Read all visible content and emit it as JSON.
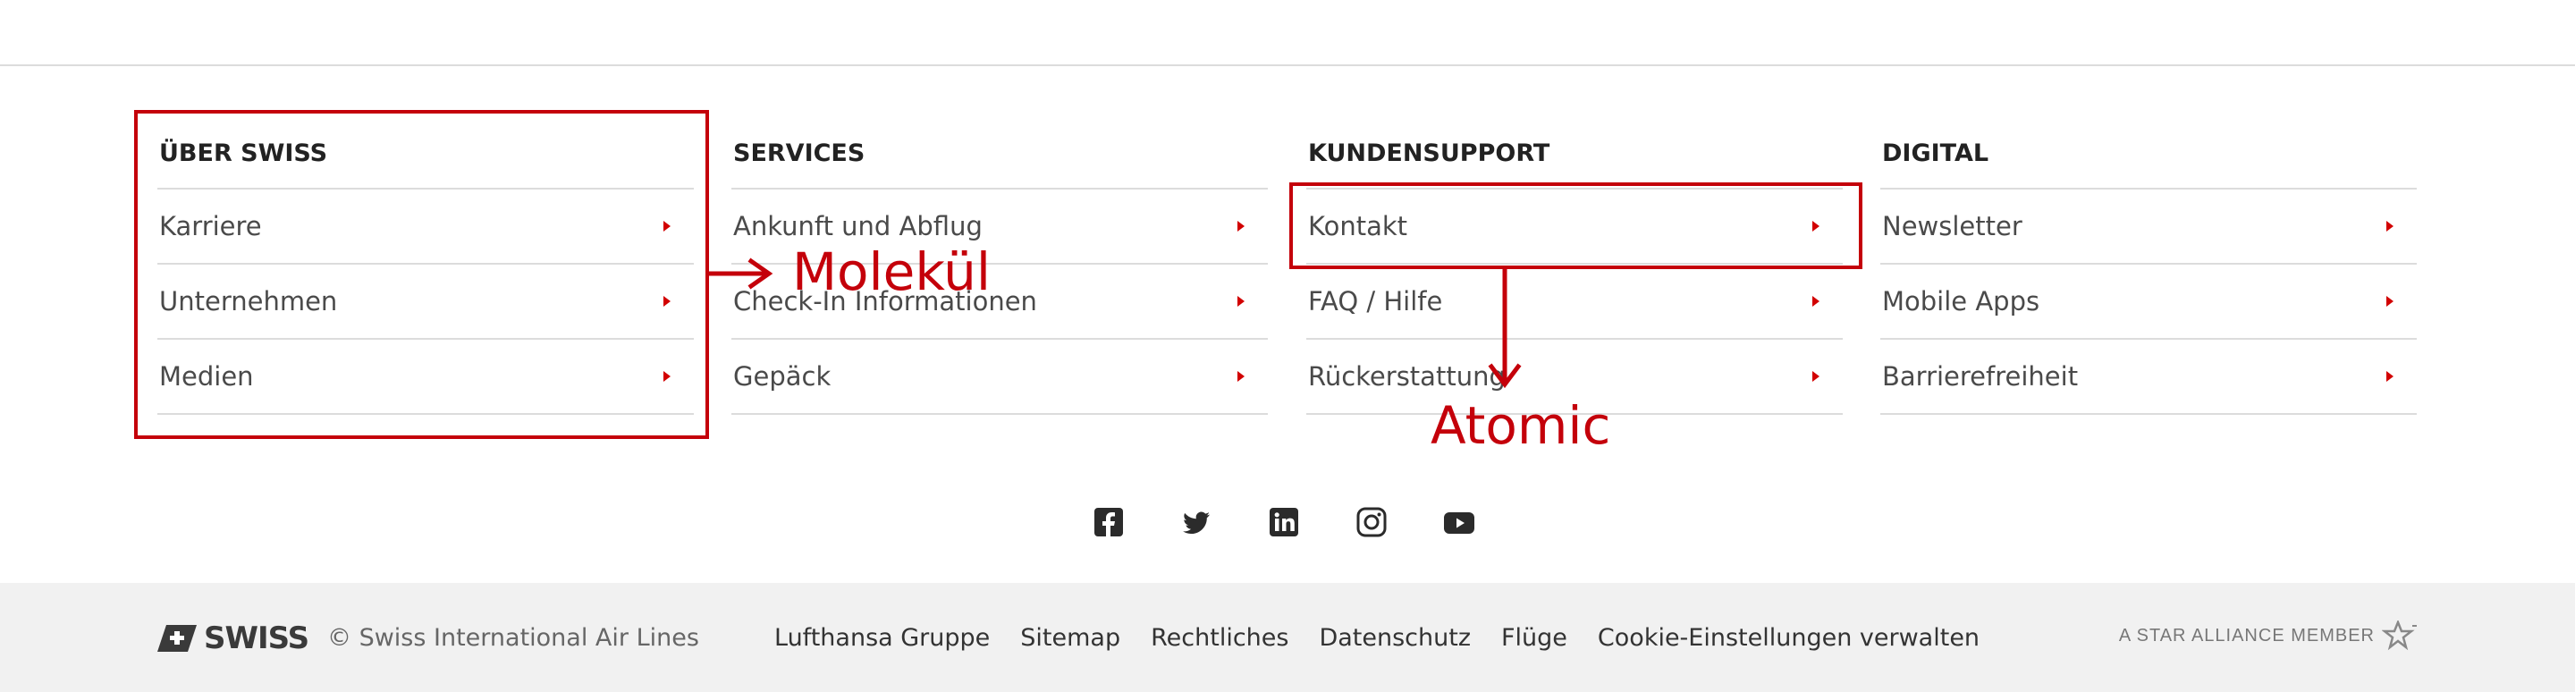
{
  "columns": [
    {
      "title": "ÜBER SWISS",
      "links": [
        "Karriere",
        "Unternehmen",
        "Medien"
      ]
    },
    {
      "title": "SERVICES",
      "links": [
        "Ankunft und Abflug",
        "Check-In Informationen",
        "Gepäck"
      ]
    },
    {
      "title": "KUNDENSUPPORT",
      "links": [
        "Kontakt",
        "FAQ / Hilfe",
        "Rückerstattung"
      ]
    },
    {
      "title": "DIGITAL",
      "links": [
        "Newsletter",
        "Mobile Apps",
        "Barrierefreiheit"
      ]
    }
  ],
  "annotations": {
    "molecule": "Molekül",
    "atomic": "Atomic",
    "color": "#c4000a"
  },
  "social_icons": [
    "facebook-icon",
    "twitter-icon",
    "linkedin-icon",
    "instagram-icon",
    "youtube-icon"
  ],
  "footer": {
    "brand": "SWISS",
    "copyright": "© Swiss International Air Lines",
    "links": [
      "Lufthansa Gruppe",
      "Sitemap",
      "Rechtliches",
      "Datenschutz",
      "Flüge",
      "Cookie-Einstellungen verwalten"
    ],
    "star_alliance": "A STAR ALLIANCE MEMBER"
  },
  "colors": {
    "accent": "#d20000",
    "background_bar": "#f1f1f1"
  }
}
